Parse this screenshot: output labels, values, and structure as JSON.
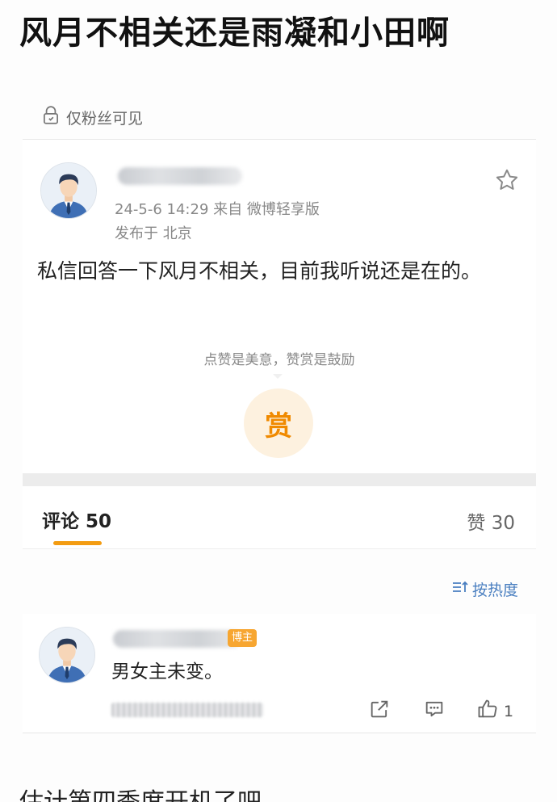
{
  "page": {
    "title": "风月不相关还是雨凝和小田啊"
  },
  "post": {
    "visibility_label": "仅粉丝可见",
    "meta_line1": "24-5-6 14:29  来自 微博轻享版",
    "meta_line2": "发布于 北京",
    "body": "私信回答一下风月不相关，目前我听说还是在的。",
    "reward_hint": "点赞是美意，赞赏是鼓励",
    "reward_button": "赏"
  },
  "tabs": {
    "comments_label": "评论 50",
    "likes_label": "赞 30"
  },
  "sort": {
    "label": "按热度"
  },
  "comment": {
    "author_badge": "博主",
    "text": "男女主未变。",
    "like_count": "1"
  },
  "footer": {
    "text": "估计第四季度开机了吧"
  },
  "colors": {
    "accent": "#f39c12",
    "link": "#4a7fc0",
    "reward": "#f08a00"
  }
}
